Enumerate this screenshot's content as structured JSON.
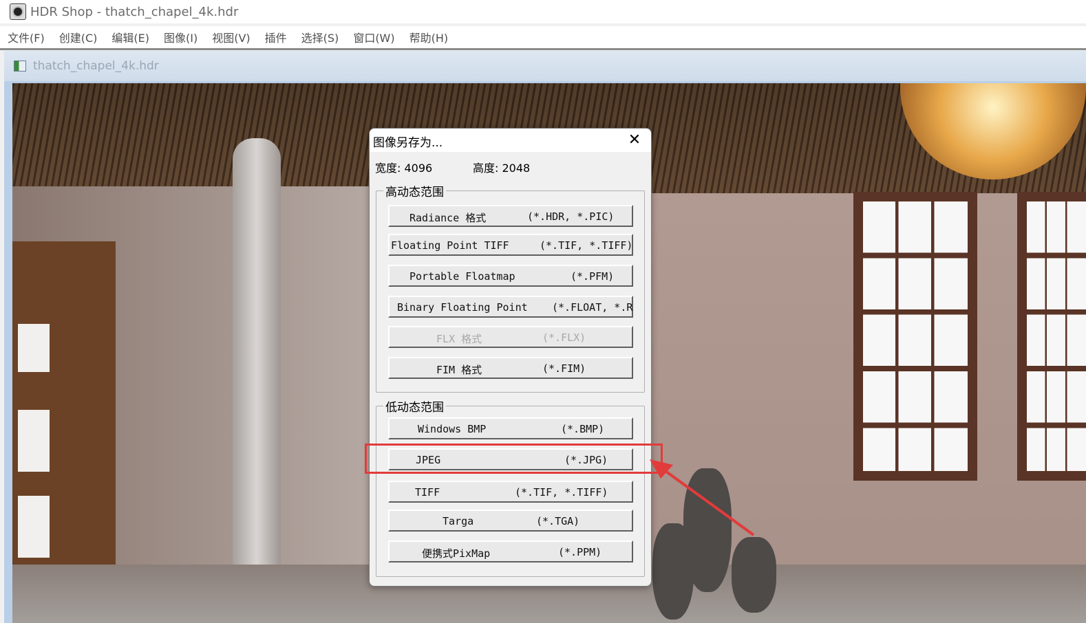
{
  "app": {
    "title": "HDR Shop - thatch_chapel_4k.hdr",
    "menu": [
      "文件(F)",
      "创建(C)",
      "编辑(E)",
      "图像(I)",
      "视图(V)",
      "插件",
      "选择(S)",
      "窗口(W)",
      "帮助(H)"
    ]
  },
  "child_window": {
    "title": "thatch_chapel_4k.hdr"
  },
  "dialog": {
    "title": "图像另存为...",
    "close": "✕",
    "width_label": "宽度: 4096",
    "height_label": "高度: 2048",
    "hdr_group_label": "高动态范围",
    "ldr_group_label": "低动态范围",
    "hdr_formats": [
      {
        "name": "Radiance 格式",
        "ext": "(*.HDR, *.PIC)"
      },
      {
        "name": "Floating Point TIFF",
        "ext": "(*.TIF, *.TIFF)"
      },
      {
        "name": "Portable Floatmap",
        "ext": "(*.PFM)"
      },
      {
        "name": "Binary Floating Point",
        "ext": "(*.FLOAT, *.R"
      },
      {
        "name": "FLX 格式",
        "ext": "(*.FLX)"
      },
      {
        "name": "FIM 格式",
        "ext": "(*.FIM)"
      }
    ],
    "ldr_formats": [
      {
        "name": "Windows BMP",
        "ext": "(*.BMP)"
      },
      {
        "name": "JPEG",
        "ext": "(*.JPG)"
      },
      {
        "name": "TIFF",
        "ext": "(*.TIF, *.TIFF)"
      },
      {
        "name": "Targa",
        "ext": "(*.TGA)"
      },
      {
        "name": "便携式PixMap",
        "ext": "(*.PPM)"
      }
    ]
  },
  "annotation": {
    "color": "#e23b3b",
    "highlighted_item": "JPEG"
  }
}
